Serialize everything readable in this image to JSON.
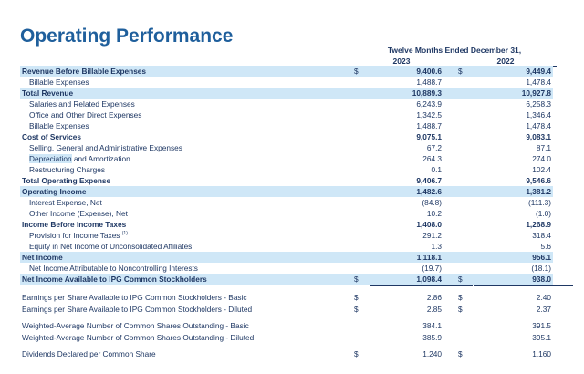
{
  "title": "Operating Performance",
  "header": {
    "period": "Twelve Months Ended December 31,",
    "year1": "2023",
    "year2": "2022"
  },
  "rows": [
    {
      "label": "Revenue Before Billable Expenses",
      "c1": "9,400.6",
      "c2": "9,449.4",
      "cur1": "$",
      "cur2": "$",
      "bold": true,
      "hl": true
    },
    {
      "label": "Billable Expenses",
      "c1": "1,488.7",
      "c2": "1,478.4",
      "indent": true
    },
    {
      "label": "Total Revenue",
      "c1": "10,889.3",
      "c2": "10,927.8",
      "bold": true,
      "hl": true
    },
    {
      "label": "Salaries and Related Expenses",
      "c1": "6,243.9",
      "c2": "6,258.3",
      "indent": true
    },
    {
      "label": "Office and Other Direct Expenses",
      "c1": "1,342.5",
      "c2": "1,346.4",
      "indent": true
    },
    {
      "label": "Billable Expenses",
      "c1": "1,488.7",
      "c2": "1,478.4",
      "indent": true
    },
    {
      "label": "Cost of Services",
      "c1": "9,075.1",
      "c2": "9,083.1",
      "bold": true
    },
    {
      "label": "Selling, General and Administrative Expenses",
      "c1": "67.2",
      "c2": "87.1",
      "indent": true
    },
    {
      "label_pre": "Depreciation",
      "label": " and Amortization",
      "c1": "264.3",
      "c2": "274.0",
      "indent": true,
      "pre_hl": true
    },
    {
      "label": "Restructuring Charges",
      "c1": "0.1",
      "c2": "102.4",
      "indent": true
    },
    {
      "label": "Total Operating Expense",
      "c1": "9,406.7",
      "c2": "9,546.6",
      "bold": true
    },
    {
      "label": "Operating Income",
      "c1": "1,482.6",
      "c2": "1,381.2",
      "bold": true,
      "hl": true
    },
    {
      "label": "Interest Expense, Net",
      "c1": "(84.8)",
      "c2": "(111.3)",
      "indent": true
    },
    {
      "label": "Other Income (Expense), Net",
      "c1": "10.2",
      "c2": "(1.0)",
      "indent": true
    },
    {
      "label": "Income Before Income Taxes",
      "c1": "1,408.0",
      "c2": "1,268.9",
      "bold": true
    },
    {
      "label": "Provision for Income Taxes",
      "sup": "(1)",
      "c1": "291.2",
      "c2": "318.4",
      "indent": true
    },
    {
      "label": "Equity in Net Income of Unconsolidated Affiliates",
      "c1": "1.3",
      "c2": "5.6",
      "indent": true
    },
    {
      "label": "Net Income",
      "c1": "1,118.1",
      "c2": "956.1",
      "bold": true,
      "hl": true
    },
    {
      "label": "Net Income Attributable to Noncontrolling Interests",
      "c1": "(19.7)",
      "c2": "(18.1)",
      "indent": true
    },
    {
      "label": "Net Income Available to IPG Common Stockholders",
      "c1": "1,098.4",
      "c2": "938.0",
      "cur1": "$",
      "cur2": "$",
      "bold": true,
      "hl": true
    }
  ],
  "eps": [
    {
      "label": "Earnings per Share Available to IPG Common Stockholders - Basic",
      "cur1": "$",
      "c1": "2.86",
      "cur2": "$",
      "c2": "2.40"
    },
    {
      "label": "Earnings per Share Available to IPG Common Stockholders - Diluted",
      "cur1": "$",
      "c1": "2.85",
      "cur2": "$",
      "c2": "2.37"
    }
  ],
  "shares": [
    {
      "label": "Weighted-Average Number of Common Shares Outstanding - Basic",
      "c1": "384.1",
      "c2": "391.5"
    },
    {
      "label": "Weighted-Average Number of Common Shares Outstanding - Diluted",
      "c1": "385.9",
      "c2": "395.1"
    }
  ],
  "dividends": {
    "label": "Dividends Declared per Common Share",
    "cur1": "$",
    "c1": "1.240",
    "cur2": "$",
    "c2": "1.160"
  }
}
